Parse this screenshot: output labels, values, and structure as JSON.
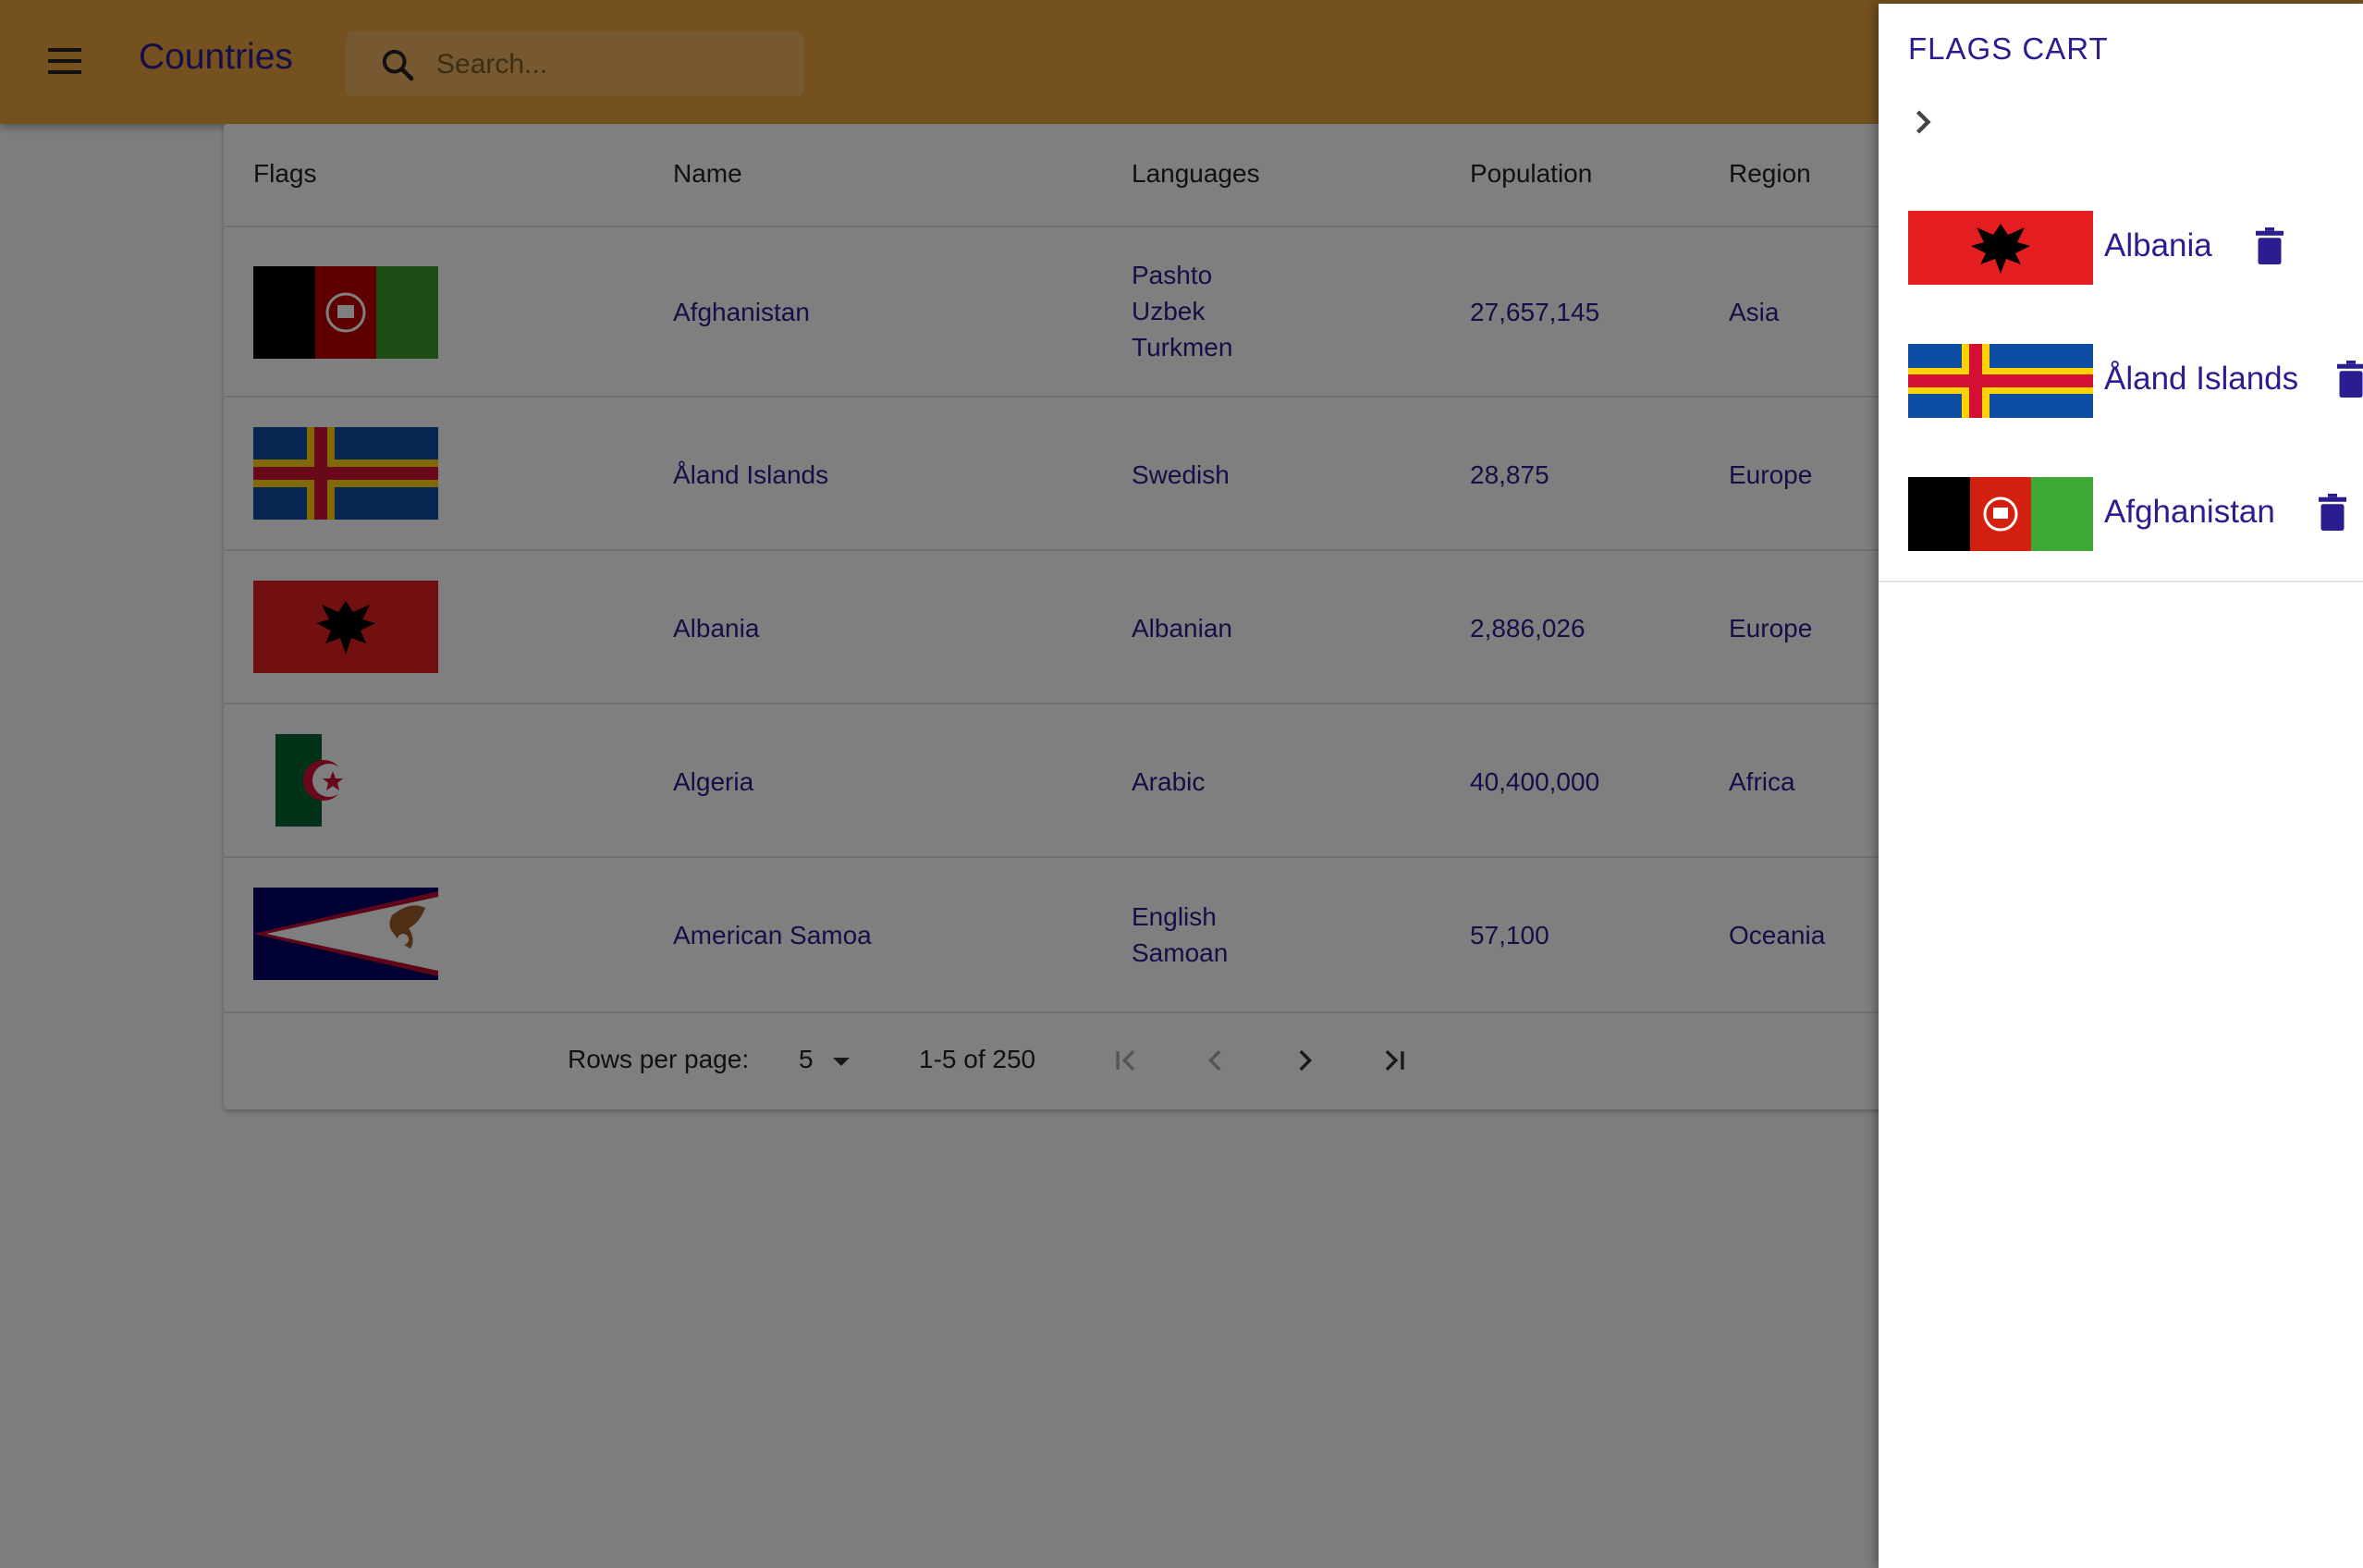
{
  "appbar": {
    "title": "Countries",
    "search_placeholder": "Search...",
    "accent": "#eaa33f"
  },
  "table": {
    "headers": [
      "Flags",
      "Name",
      "Languages",
      "Population",
      "Region"
    ],
    "rows": [
      {
        "flag": "afghanistan-flag",
        "name": "Afghanistan",
        "languages": [
          "Pashto",
          "Uzbek",
          "Turkmen"
        ],
        "population": "27,657,145",
        "region": "Asia"
      },
      {
        "flag": "aland-flag",
        "name": "Åland Islands",
        "languages": [
          "Swedish"
        ],
        "population": "28,875",
        "region": "Europe"
      },
      {
        "flag": "albania-flag",
        "name": "Albania",
        "languages": [
          "Albanian"
        ],
        "population": "2,886,026",
        "region": "Europe"
      },
      {
        "flag": "algeria-flag",
        "name": "Algeria",
        "languages": [
          "Arabic"
        ],
        "population": "40,400,000",
        "region": "Africa"
      },
      {
        "flag": "american-samoa-flag",
        "name": "American Samoa",
        "languages": [
          "English",
          "Samoan"
        ],
        "population": "57,100",
        "region": "Oceania"
      }
    ]
  },
  "pagination": {
    "rows_label": "Rows per page:",
    "rows_value": "5",
    "range": "1-5 of 250"
  },
  "drawer": {
    "title": "FLAGS CART",
    "items": [
      {
        "name": "Albania",
        "flag": "albania-flag"
      },
      {
        "name": "Åland Islands",
        "flag": "aland-flag"
      },
      {
        "name": "Afghanistan",
        "flag": "afghanistan-flag"
      }
    ]
  },
  "colors": {
    "primary_text": "#2a1d8f",
    "overlay": "rgba(0,0,0,0.5)"
  }
}
